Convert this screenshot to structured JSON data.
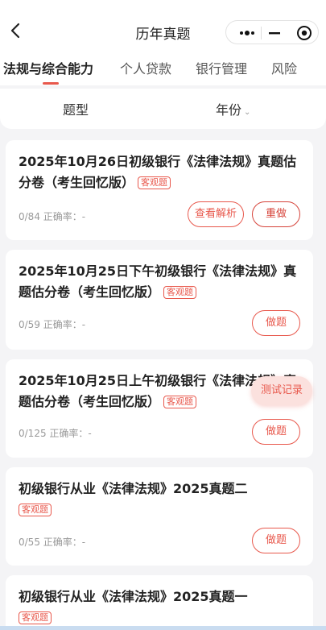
{
  "header": {
    "title": "历年真题",
    "back_icon": "chevron-left-icon",
    "capsule_icons": [
      "more-dots-icon",
      "minimize-icon",
      "target-close-icon"
    ]
  },
  "tabs": [
    {
      "label": "法规与综合能力",
      "active": true
    },
    {
      "label": "个人贷款",
      "active": false
    },
    {
      "label": "银行管理",
      "active": false
    },
    {
      "label": "风险",
      "active": false
    }
  ],
  "filters": {
    "type_label": "题型",
    "year_label": "年份"
  },
  "cards": [
    {
      "title": "2025年10月26日初级银行《法律法规》真题估分卷（考生回忆版）",
      "badge": "客观题",
      "stats": "0/84 正确率：-",
      "buttons": [
        "查看解析",
        "重做"
      ]
    },
    {
      "title": "2025年10月25日下午初级银行《法律法规》真题估分卷（考生回忆版）",
      "badge": "客观题",
      "stats": "0/59 正确率：-",
      "buttons": [
        "做题"
      ]
    },
    {
      "title": "2025年10月25日上午初级银行《法律法规》真题估分卷（考生回忆版）",
      "badge": "客观题",
      "stats": "0/125 正确率：-",
      "buttons": [
        "做题"
      ]
    },
    {
      "title": "初级银行从业《法律法规》2025真题二",
      "badge": "客观题",
      "stats": "0/55 正确率：-",
      "buttons": [
        "做题"
      ]
    },
    {
      "title": "初级银行从业《法律法规》2025真题一",
      "badge": "客观题",
      "stats": "",
      "buttons": []
    }
  ],
  "float_button": "测试记录",
  "colors": {
    "accent": "#e8584c",
    "background": "#f4f4f6"
  }
}
